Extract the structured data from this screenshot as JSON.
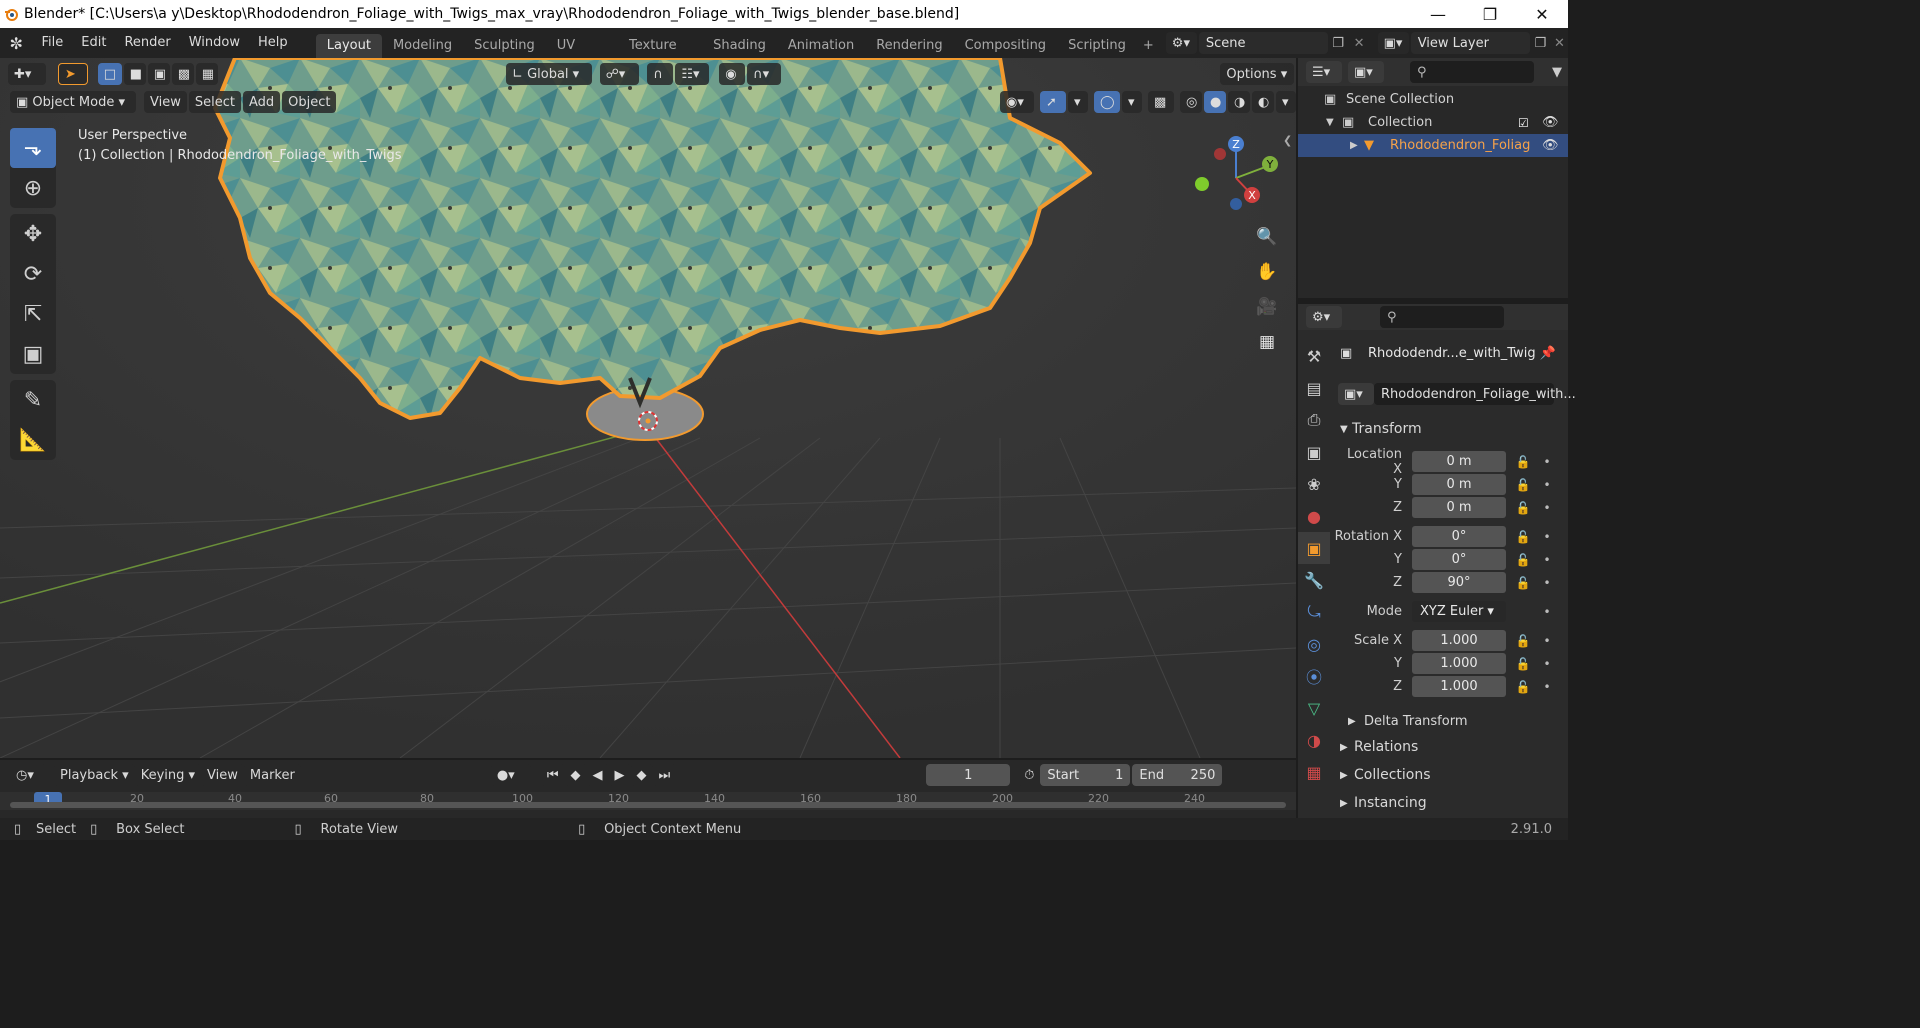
{
  "window": {
    "title": "Blender* [C:\\Users\\a y\\Desktop\\Rhododendron_Foliage_with_Twigs_max_vray\\Rhododendron_Foliage_with_Twigs_blender_base.blend]",
    "minimize_icon": "minimize-icon",
    "maximize_icon": "restore-icon",
    "close_icon": "close-icon"
  },
  "menu": {
    "items": [
      "File",
      "Edit",
      "Render",
      "Window",
      "Help"
    ]
  },
  "workspaces": {
    "tabs": [
      "Layout",
      "Modeling",
      "Sculpting",
      "UV Editing",
      "Texture Paint",
      "Shading",
      "Animation",
      "Rendering",
      "Compositing",
      "Scripting"
    ],
    "active": "Layout",
    "add_label": "+"
  },
  "scene": {
    "scene_name": "Scene",
    "view_layer": "View Layer"
  },
  "viewport_header": {
    "transform_orientation": "Global",
    "options_label": "Options",
    "mode": "Object Mode",
    "menus": [
      "View",
      "Select",
      "Add",
      "Object"
    ]
  },
  "viewport": {
    "perspective_label": "User Perspective",
    "collection_label": "(1) Collection | Rhododendron_Foliage_with_Twigs",
    "gizmo": {
      "x": "X",
      "y": "Y",
      "z": "Z"
    },
    "colors": {
      "background": "#393939",
      "selection_outline": "#f29a2e",
      "foliage_light": "#8fb08a",
      "foliage_teal": "#4f9a94",
      "x_axis": "#c23b3b",
      "y_axis": "#6a8f3a"
    }
  },
  "outliner": {
    "search_placeholder": "",
    "scene_collection": "Scene Collection",
    "collection": "Collection",
    "object": "Rhododendron_Foliag"
  },
  "properties": {
    "object_name": "Rhododendr...e_with_Twig",
    "data_name": "Rhododendron_Foliage_with...",
    "transform_header": "Transform",
    "location": {
      "label": "Location X",
      "x": "0 m",
      "y": "0 m",
      "z": "0 m"
    },
    "rotation": {
      "label": "Rotation X",
      "x": "0°",
      "y": "0°",
      "z": "90°"
    },
    "mode_label": "Mode",
    "mode_value": "XYZ Euler",
    "scale": {
      "label": "Scale X",
      "x": "1.000",
      "y": "1.000",
      "z": "1.000"
    },
    "axis_y": "Y",
    "axis_z": "Z",
    "delta_transform": "Delta Transform",
    "relations": "Relations",
    "collections": "Collections",
    "instancing": "Instancing"
  },
  "timeline": {
    "menus": [
      "Playback",
      "Keying",
      "View",
      "Marker"
    ],
    "current_frame": "1",
    "start_label": "Start",
    "start_value": "1",
    "end_label": "End",
    "end_value": "250",
    "ruler": [
      "1",
      "20",
      "40",
      "60",
      "80",
      "100",
      "120",
      "140",
      "160",
      "180",
      "200",
      "220",
      "240"
    ]
  },
  "statusbar": {
    "select": "Select",
    "box_select": "Box Select",
    "rotate_view": "Rotate View",
    "context_menu": "Object Context Menu",
    "version": "2.91.0"
  }
}
